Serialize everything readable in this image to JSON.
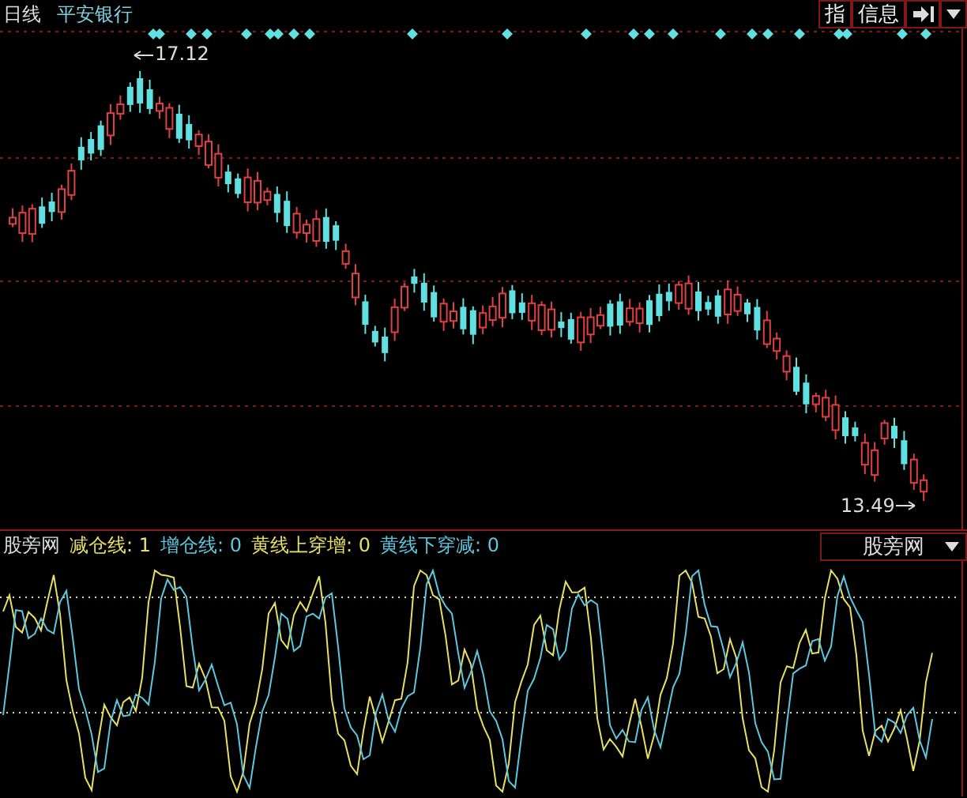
{
  "header": {
    "period": "日线",
    "stock_name": "平安银行",
    "buttons": [
      {
        "kind": "text",
        "label": "指"
      },
      {
        "kind": "text",
        "label": "信息"
      },
      {
        "kind": "pin"
      },
      {
        "kind": "caret"
      }
    ]
  },
  "main_chart": {
    "high_label": "17.12",
    "low_label": "13.49"
  },
  "indicator": {
    "name": "股旁网",
    "values": [
      {
        "label": "减仓线: 1",
        "color": "#e8e060"
      },
      {
        "label": "增仓线: 0",
        "color": "#5cc8e0"
      },
      {
        "label": "黄线上穿增: 0",
        "color": "#e8e060"
      },
      {
        "label": "黄线下穿减: 0",
        "color": "#5cc8e0"
      }
    ],
    "selector": "股旁网"
  }
}
